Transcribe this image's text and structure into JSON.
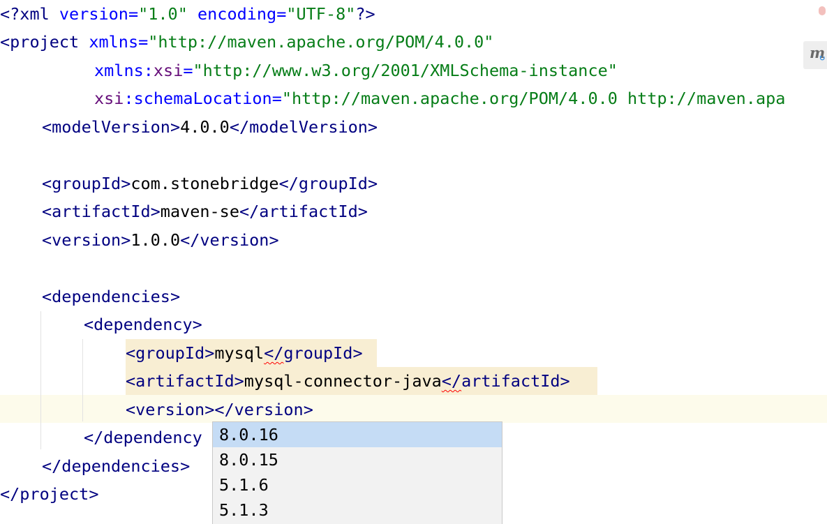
{
  "editor": {
    "language": "xml",
    "lines": {
      "l1": {
        "open": "<?",
        "name": "xml",
        "a1": "version",
        "v1": "\"1.0\"",
        "a2": "encoding",
        "v2": "\"UTF-8\"",
        "close": "?>"
      },
      "l2": {
        "open": "<",
        "name": "project",
        "attr": "xmlns",
        "eq": "=",
        "value": "\"http://maven.apache.org/POM/4.0.0\""
      },
      "l3": {
        "ns": "xmlns",
        "colon": ":",
        "attr": "xsi",
        "eq": "=",
        "value": "\"http://www.w3.org/2001/XMLSchema-instance\""
      },
      "l4": {
        "ns": "xsi",
        "colon": ":",
        "attr": "schemaLocation",
        "eq": "=",
        "value": "\"http://maven.apache.org/POM/4.0.0 http://maven.apa"
      },
      "l5": {
        "name": "modelVersion",
        "text": "4.0.0"
      },
      "l7": {
        "name": "groupId",
        "text": "com.stonebridge"
      },
      "l8": {
        "name": "artifactId",
        "text": "maven-se"
      },
      "l9": {
        "name": "version",
        "text": "1.0.0"
      },
      "l11": {
        "name": "dependencies"
      },
      "l12": {
        "name": "dependency"
      },
      "l13": {
        "name": "groupId",
        "text": "mysql"
      },
      "l14": {
        "name": "artifactId",
        "text": "mysql-connector-java"
      },
      "l15": {
        "name": "version",
        "text": ""
      },
      "l16": {
        "close_visible": "</",
        "name_visible": "dependency"
      },
      "l17": {
        "name": "dependencies"
      },
      "l18": {
        "name": "project"
      }
    },
    "punct": {
      "lt": "<",
      "gt": ">",
      "lt_slash": "</",
      "eq": "="
    }
  },
  "completion_popup": {
    "selected_index": 0,
    "items": [
      "8.0.16",
      "8.0.15",
      "5.1.6",
      "5.1.3"
    ]
  },
  "icons": {
    "error_marker": "error-stripe-icon",
    "maven_reload": "maven-reload-icon",
    "maven_letter": "m"
  },
  "colors": {
    "tag": "#000080",
    "attribute": "#0000ff",
    "namespace": "#660e7a",
    "string": "#067d17",
    "selection": "#c5dcf5",
    "caret_row": "#fdfbeb",
    "tag_highlight": "#f8eed3"
  }
}
